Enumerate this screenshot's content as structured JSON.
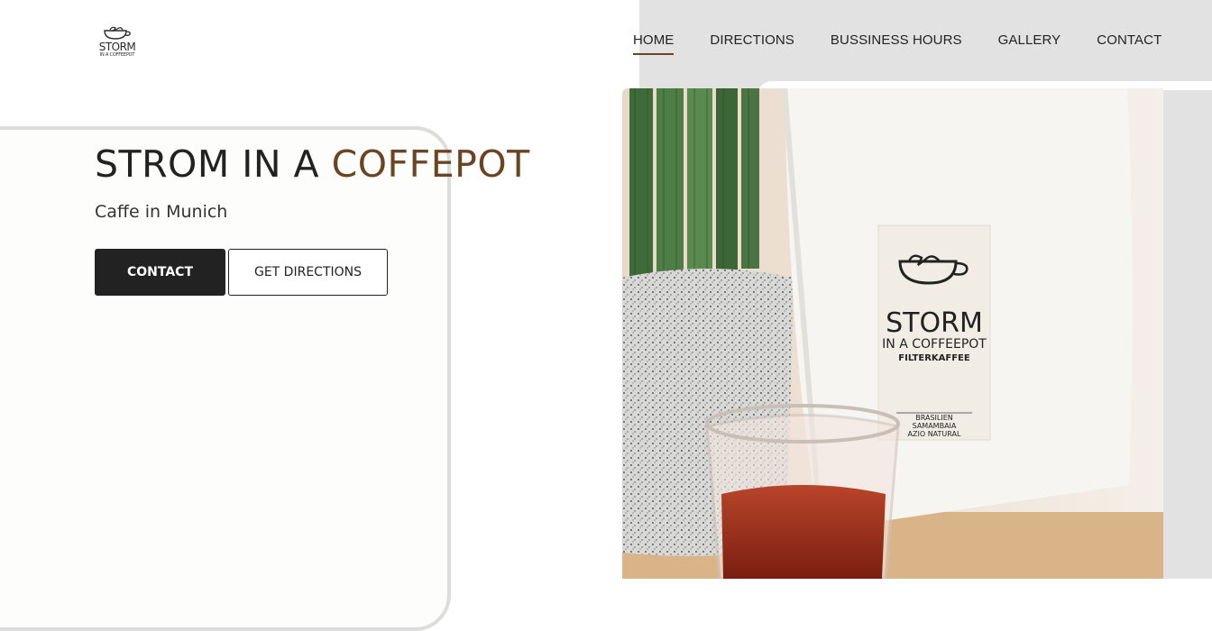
{
  "logo": {
    "line1": "STORM",
    "line2": "IN A COFFEEPOT"
  },
  "nav": {
    "items": [
      {
        "label": "HOME",
        "active": true
      },
      {
        "label": "DIRECTIONS",
        "active": false
      },
      {
        "label": "BUSSINESS HOURS",
        "active": false
      },
      {
        "label": "GALLERY",
        "active": false
      },
      {
        "label": "CONTACT",
        "active": false
      }
    ]
  },
  "hero": {
    "title_main": "STROM IN A ",
    "title_accent": "COFFEPOT",
    "subtitle": "Caffe in Munich",
    "contact_button": "CONTACT",
    "directions_button": "GET DIRECTIONS"
  },
  "photo": {
    "bag_label_line1": "STORM",
    "bag_label_line2": "IN A COFFEEPOT",
    "bag_label_line3": "FILTERKAFFEE",
    "bag_label_line4": "BRASILIEN",
    "bag_label_line5": "SAMAMBAIA",
    "bag_label_line6": "AZIO NATURAL"
  },
  "colors": {
    "accent": "#6b4423",
    "dark": "#222222",
    "panel_grey": "#e2e2e2"
  }
}
